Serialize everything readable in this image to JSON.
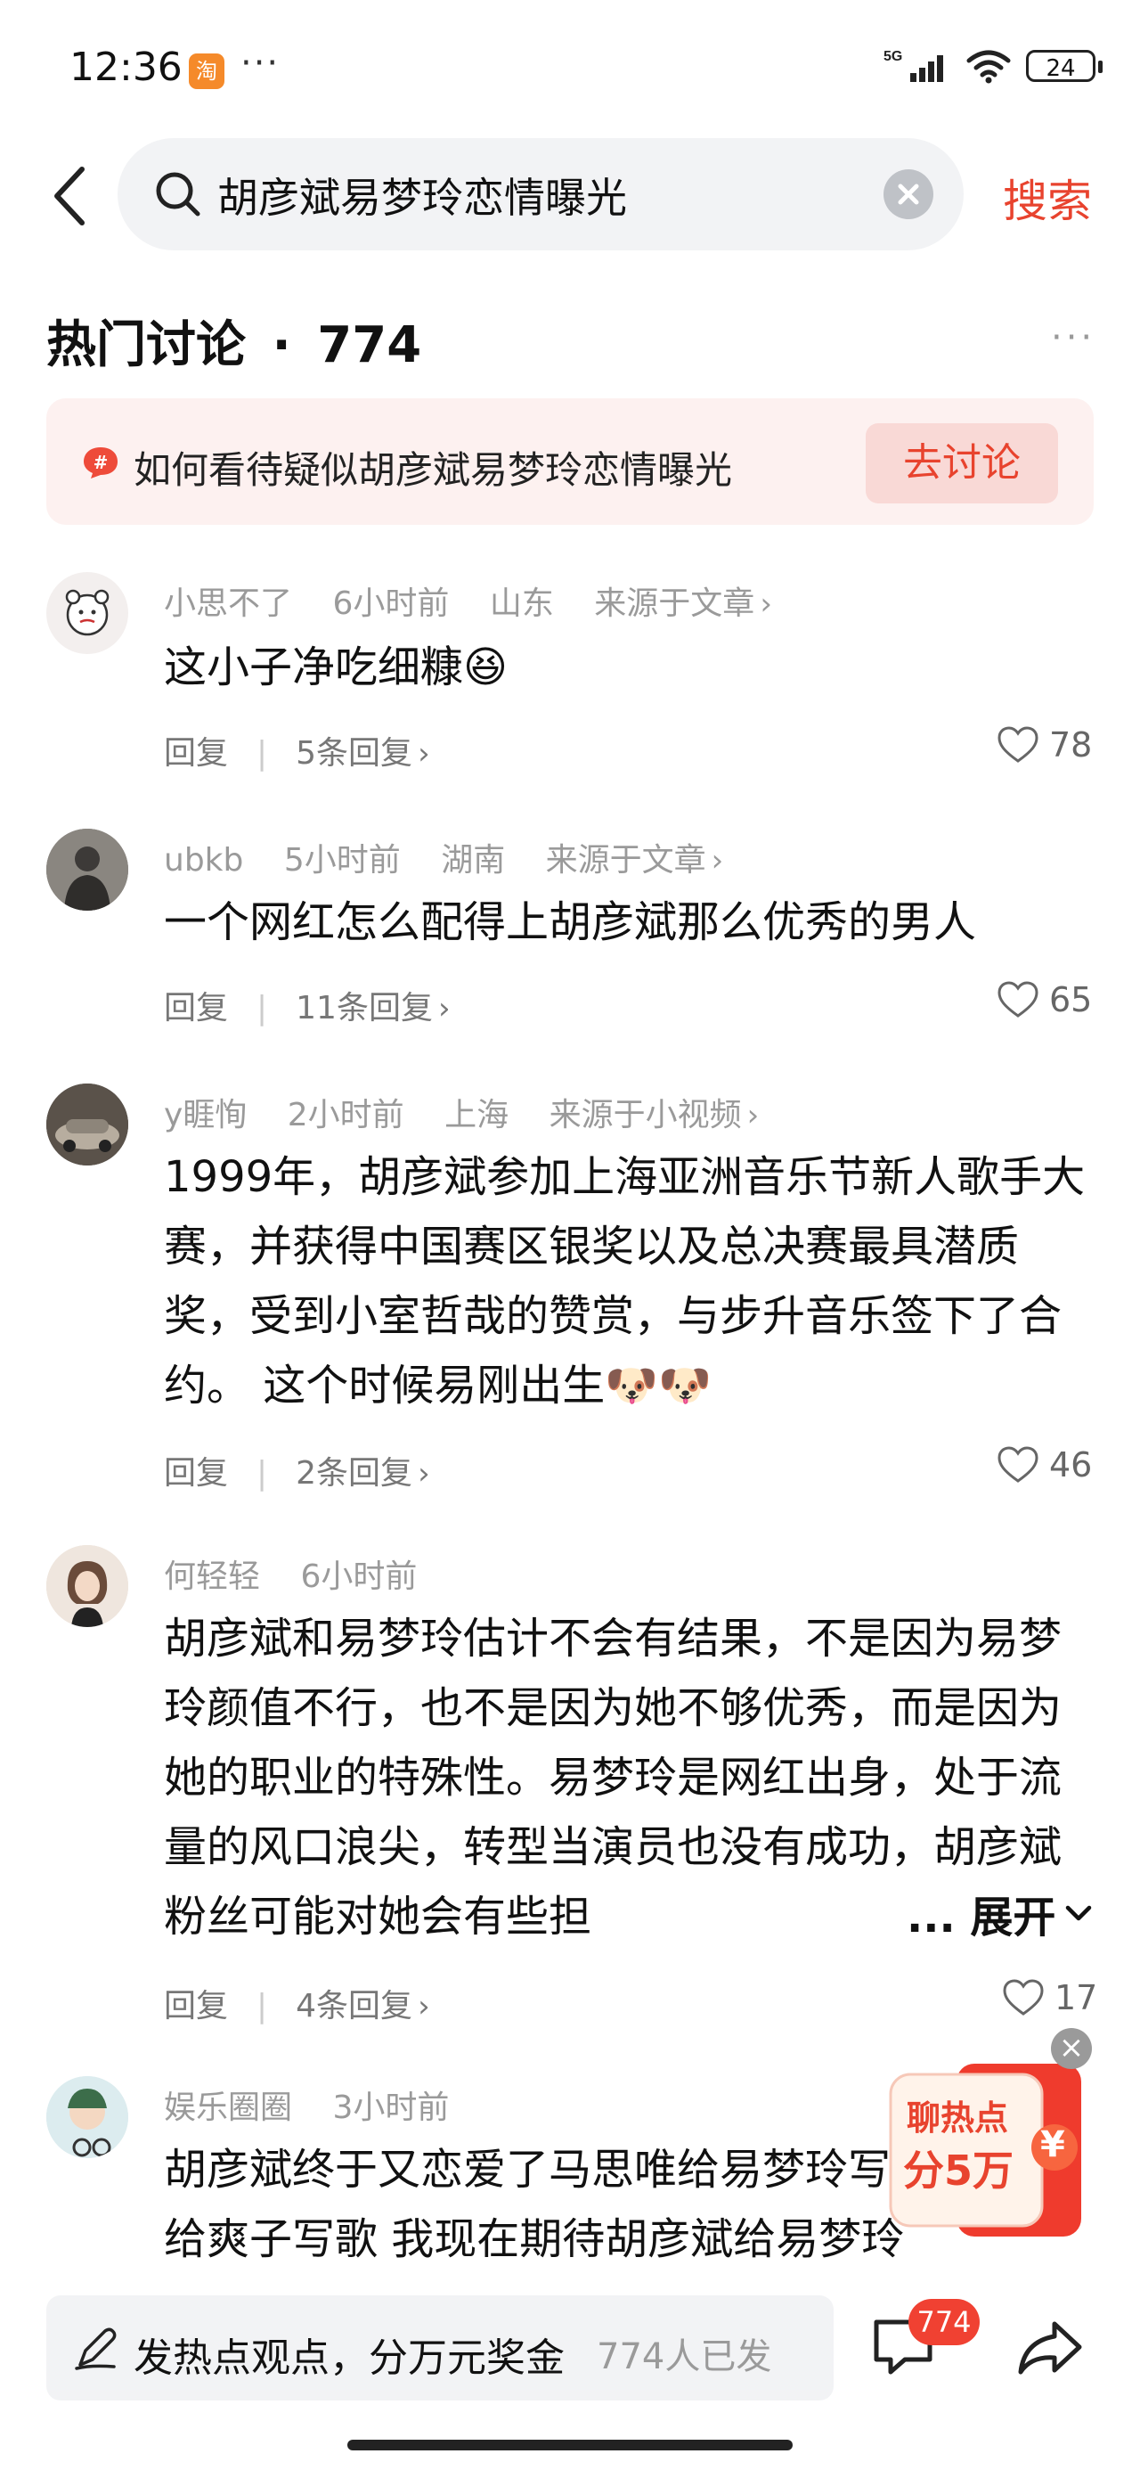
{
  "status_bar": {
    "time": "12:36",
    "app_badge": "淘",
    "dots": "···",
    "network": "5G",
    "battery": "24"
  },
  "search": {
    "query": "胡彦斌易梦玲恋情曝光",
    "button": "搜索"
  },
  "hot": {
    "title": "热门讨论",
    "separator": "·",
    "count": "774",
    "more": "···"
  },
  "topic": {
    "text": "如何看待疑似胡彦斌易梦玲恋情曝光",
    "button": "去讨论"
  },
  "comments": [
    {
      "user": "小思不了",
      "time": "6小时前",
      "location": "山东",
      "source": "来源于文章",
      "text": "这小子净吃细糠😆",
      "reply": "回复",
      "replies": "5条回复",
      "likes": "78"
    },
    {
      "user": "ubkb",
      "time": "5小时前",
      "location": "湖南",
      "source": "来源于文章",
      "text": "一个网红怎么配得上胡彦斌那么优秀的男人",
      "reply": "回复",
      "replies": "11条回复",
      "likes": "65"
    },
    {
      "user": "y睚恂",
      "time": "2小时前",
      "location": "上海",
      "source": "来源于小视频",
      "text": "1999年，胡彦斌参加上海亚洲音乐节新人歌手大赛，并获得中国赛区银奖以及总决赛最具潜质奖，受到小室哲哉的赞赏，与步升音乐签下了合约。 这个时候易刚出生🐶🐶",
      "reply": "回复",
      "replies": "2条回复",
      "likes": "46"
    },
    {
      "user": "何轻轻",
      "time": "6小时前",
      "text": "胡彦斌和易梦玲估计不会有结果，不是因为易梦玲颜值不行，也不是因为她不够优秀，而是因为她的职业的特殊性。易梦玲是网红出身，处于流量的风口浪尖，转型当演员也没有成功，胡彦斌粉丝可能对她会有些担",
      "expand": "... 展开",
      "reply": "回复",
      "replies": "4条回复",
      "likes": "17"
    },
    {
      "user": "娱乐圈圈",
      "time": "3小时前",
      "text": "胡彦斌终于又恋爱了马思唯给易梦玲写歌 胡彦斌给爽子写歌 我现在期待胡彦斌给易梦玲"
    }
  ],
  "ad": {
    "line1": "聊热点",
    "line2": "分5万",
    "currency": "¥",
    "close": "×"
  },
  "bottom_bar": {
    "placeholder": "发热点观点，分万元奖金",
    "count": "774人已发",
    "comment_badge": "774"
  },
  "colors": {
    "accent": "#e8432e",
    "banner_bg": "#fdf1f0",
    "badge": "#f04132"
  }
}
